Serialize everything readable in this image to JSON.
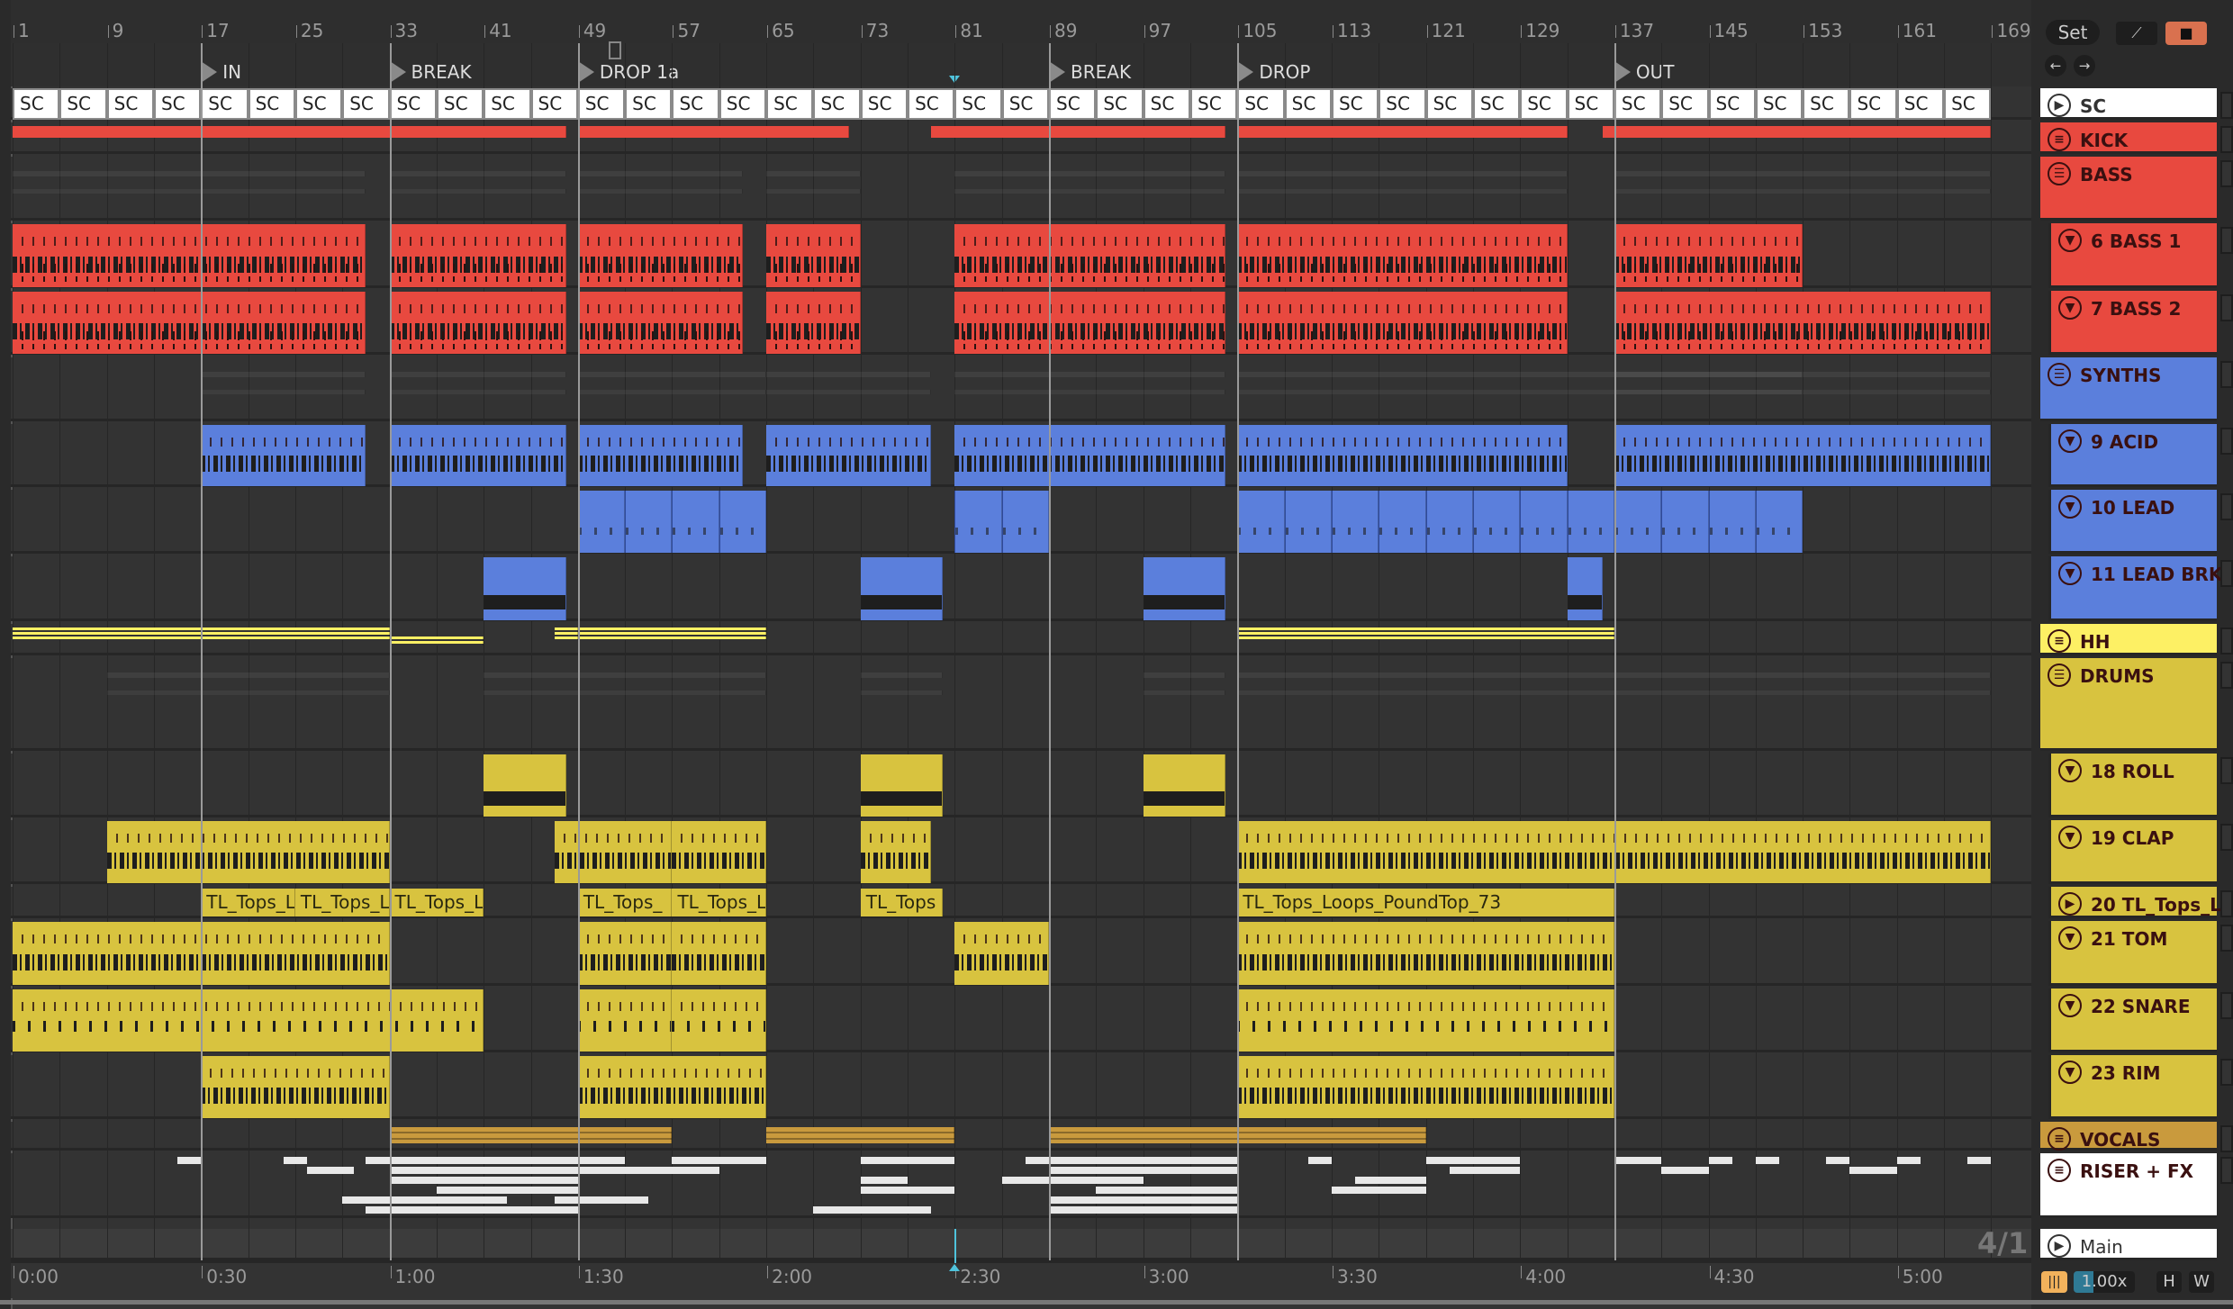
{
  "ruler": {
    "bars": [
      "1",
      "9",
      "17",
      "25",
      "33",
      "41",
      "49",
      "57",
      "65",
      "73",
      "81",
      "89",
      "97",
      "105",
      "113",
      "121",
      "129",
      "137",
      "145",
      "153",
      "161",
      "169"
    ]
  },
  "locators": [
    {
      "label": "IN",
      "bar": 17
    },
    {
      "label": "BREAK",
      "bar": 33
    },
    {
      "label": "DROP 1a",
      "bar": 49
    },
    {
      "label": "BREAK",
      "bar": 89
    },
    {
      "label": "DROP",
      "bar": 105
    },
    {
      "label": "OUT",
      "bar": 137
    }
  ],
  "time_ruler": [
    "0:00",
    "0:30",
    "1:00",
    "1:30",
    "2:00",
    "2:30",
    "3:00",
    "3:30",
    "4:00",
    "4:30",
    "5:00"
  ],
  "playhead_bar": 81,
  "time_signature": "4/1",
  "sc_clip_label": "SC",
  "controls": {
    "set": "Set",
    "zoom": "1.00x",
    "h": "H",
    "w": "W"
  },
  "colors": {
    "red": "#e8493f",
    "blue": "#5b7fdc",
    "yellow": "#d8c33f",
    "hh": "#fdf064",
    "vocals": "#c99a3d",
    "sc": "#ffffff",
    "lock": "#d9714f"
  },
  "tracks": [
    {
      "name": "SC",
      "icon": "play",
      "color": "#ffffff",
      "clips": []
    },
    {
      "name": "KICK",
      "icon": "group",
      "color": "#e8493f",
      "style": "kick",
      "clips": [
        [
          1,
          48
        ],
        [
          49,
          72
        ],
        [
          79,
          104
        ],
        [
          105,
          133
        ],
        [
          136,
          169
        ]
      ]
    },
    {
      "name": "BASS",
      "icon": "group-folded",
      "color": "#e8493f",
      "style": "overview",
      "clips": [
        [
          1,
          31
        ],
        [
          33,
          48
        ],
        [
          49,
          63
        ],
        [
          65,
          73
        ],
        [
          81,
          104
        ],
        [
          105,
          133
        ],
        [
          137,
          169
        ]
      ]
    },
    {
      "name": "6 BASS 1",
      "icon": "arm",
      "color": "#e8493f",
      "nested": true,
      "style": "red",
      "clips": [
        [
          1,
          31
        ],
        [
          33,
          48
        ],
        [
          49,
          63
        ],
        [
          65,
          73
        ],
        [
          81,
          104
        ],
        [
          105,
          133
        ],
        [
          137,
          153
        ]
      ]
    },
    {
      "name": "7 BASS 2",
      "icon": "arm",
      "color": "#e8493f",
      "nested": true,
      "style": "red",
      "clips": [
        [
          1,
          31
        ],
        [
          33,
          48
        ],
        [
          49,
          63
        ],
        [
          65,
          73
        ],
        [
          81,
          104
        ],
        [
          105,
          133
        ],
        [
          137,
          169
        ]
      ]
    },
    {
      "name": "SYNTHS",
      "icon": "group-folded",
      "color": "#5b7fdc",
      "style": "overview",
      "clips": [
        [
          17,
          31
        ],
        [
          33,
          48
        ],
        [
          49,
          65
        ],
        [
          65,
          79
        ],
        [
          81,
          104
        ],
        [
          105,
          153
        ],
        [
          137,
          169
        ]
      ]
    },
    {
      "name": "9 ACID",
      "icon": "arm",
      "color": "#5b7fdc",
      "nested": true,
      "style": "blue",
      "clips": [
        [
          17,
          31
        ],
        [
          33,
          48
        ],
        [
          49,
          63
        ],
        [
          65,
          79
        ],
        [
          81,
          104
        ],
        [
          105,
          133
        ],
        [
          137,
          169
        ]
      ]
    },
    {
      "name": "10 LEAD",
      "icon": "arm",
      "color": "#5b7fdc",
      "nested": true,
      "style": "lead",
      "clips": [
        [
          49,
          65
        ],
        [
          81,
          89
        ],
        [
          105,
          153
        ]
      ]
    },
    {
      "name": "11 LEAD BRK",
      "icon": "arm",
      "color": "#5b7fdc",
      "nested": true,
      "style": "brk",
      "clips": [
        [
          41,
          48
        ],
        [
          73,
          80
        ],
        [
          97,
          104
        ],
        [
          133,
          136
        ]
      ]
    },
    {
      "name": "HH",
      "icon": "group",
      "color": "#fdf064",
      "style": "hh",
      "clips": [
        [
          1,
          33
        ],
        [
          33,
          41
        ],
        [
          47,
          49
        ],
        [
          49,
          65
        ],
        [
          105,
          137
        ]
      ]
    },
    {
      "name": "DRUMS",
      "icon": "group-folded",
      "color": "#d8c33f",
      "style": "overview",
      "clips": [
        [
          9,
          33
        ],
        [
          41,
          65
        ],
        [
          73,
          80
        ],
        [
          97,
          104
        ],
        [
          105,
          169
        ]
      ]
    },
    {
      "name": "18 ROLL",
      "icon": "arm",
      "color": "#d8c33f",
      "nested": true,
      "style": "brk",
      "clips": [
        [
          41,
          48
        ],
        [
          73,
          80
        ],
        [
          97,
          104
        ]
      ]
    },
    {
      "name": "19 CLAP",
      "icon": "arm",
      "color": "#d8c33f",
      "nested": true,
      "style": "yel",
      "clips": [
        [
          9,
          33
        ],
        [
          47,
          57
        ],
        [
          57,
          65
        ],
        [
          73,
          79
        ],
        [
          105,
          169
        ]
      ]
    },
    {
      "name": "20 TL_Tops_L",
      "icon": "play",
      "color": "#d8c33f",
      "nested": true,
      "style": "tl",
      "clips": [
        [
          17,
          25,
          "TL_Tops_L"
        ],
        [
          25,
          33,
          "TL_Tops_L"
        ],
        [
          33,
          41,
          "TL_Tops_L"
        ],
        [
          49,
          57,
          "TL_Tops_"
        ],
        [
          57,
          65,
          "TL_Tops_L"
        ],
        [
          73,
          80,
          "TL_Tops"
        ],
        [
          105,
          137,
          "TL_Tops_Loops_PoundTop_73"
        ]
      ]
    },
    {
      "name": "21 TOM",
      "icon": "arm",
      "color": "#d8c33f",
      "nested": true,
      "style": "yel",
      "clips": [
        [
          1,
          33
        ],
        [
          49,
          57
        ],
        [
          57,
          65
        ],
        [
          81,
          89
        ],
        [
          105,
          137
        ]
      ]
    },
    {
      "name": "22 SNARE",
      "icon": "arm",
      "color": "#d8c33f",
      "nested": true,
      "style": "yel2",
      "clips": [
        [
          1,
          41
        ],
        [
          49,
          57
        ],
        [
          57,
          65
        ],
        [
          105,
          137
        ]
      ]
    },
    {
      "name": "23 RIM",
      "icon": "arm",
      "color": "#d8c33f",
      "nested": true,
      "style": "rim",
      "clips": [
        [
          17,
          33
        ],
        [
          49,
          65
        ],
        [
          105,
          137
        ]
      ]
    },
    {
      "name": "VOCALS",
      "icon": "group",
      "color": "#c99a3d",
      "style": "vox",
      "clips": [
        [
          33,
          57
        ],
        [
          65,
          81
        ],
        [
          89,
          121
        ]
      ]
    },
    {
      "name": "RISER + FX",
      "icon": "group",
      "color": "#ffffff",
      "style": "riser",
      "clips": [
        [
          15,
          17,
          0
        ],
        [
          24,
          26,
          0
        ],
        [
          26,
          30,
          1
        ],
        [
          31,
          33,
          0
        ],
        [
          33,
          49,
          0
        ],
        [
          33,
          49,
          1
        ],
        [
          33,
          49,
          2
        ],
        [
          37,
          49,
          3
        ],
        [
          29,
          43,
          4
        ],
        [
          31,
          49,
          5
        ],
        [
          43,
          53,
          0
        ],
        [
          49,
          57,
          1
        ],
        [
          47,
          55,
          4
        ],
        [
          57,
          61,
          0
        ],
        [
          57,
          61,
          1
        ],
        [
          61,
          65,
          0
        ],
        [
          73,
          81,
          0
        ],
        [
          73,
          77,
          2
        ],
        [
          73,
          81,
          3
        ],
        [
          69,
          79,
          5
        ],
        [
          87,
          89,
          0
        ],
        [
          85,
          89,
          2
        ],
        [
          89,
          105,
          0
        ],
        [
          89,
          105,
          1
        ],
        [
          89,
          97,
          2
        ],
        [
          93,
          105,
          3
        ],
        [
          89,
          105,
          4
        ],
        [
          89,
          105,
          5
        ],
        [
          111,
          113,
          0
        ],
        [
          115,
          121,
          2
        ],
        [
          113,
          121,
          3
        ],
        [
          121,
          129,
          0
        ],
        [
          123,
          129,
          1
        ],
        [
          137,
          141,
          0
        ],
        [
          141,
          145,
          1
        ],
        [
          145,
          147,
          0
        ],
        [
          149,
          151,
          0
        ],
        [
          155,
          157,
          0
        ],
        [
          157,
          161,
          1
        ],
        [
          161,
          163,
          0
        ],
        [
          167,
          169,
          0
        ]
      ]
    }
  ],
  "master": {
    "name": "Main",
    "icon": "play"
  }
}
